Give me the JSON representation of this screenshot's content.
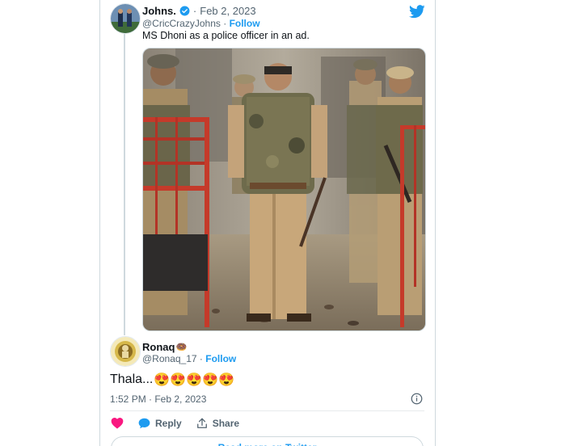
{
  "tweet": {
    "author_name": "Johns.",
    "date": "Feb 2, 2023",
    "handle": "@CricCrazyJohns",
    "follow_label": "Follow",
    "text": "MS Dhoni as a police officer in an ad.",
    "separator": "·"
  },
  "reply": {
    "author_name": "Ronaq",
    "name_emoji": "🍩",
    "handle": "@Ronaq_17",
    "follow_label": "Follow",
    "text": "Thala...",
    "emojis": "😍😍😍😍😍",
    "timestamp": "1:52 PM · Feb 2, 2023",
    "reply_label": "Reply",
    "share_label": "Share",
    "read_more_label": "Read more on Twitter"
  },
  "colors": {
    "accent": "#1d9bf0",
    "like": "#f91880",
    "muted": "#536471"
  },
  "icons": {
    "brand": "twitter-bird-icon",
    "verified": "verified-badge-icon",
    "info": "info-icon",
    "like": "heart-icon",
    "reply": "speech-bubble-icon",
    "share": "share-upload-icon"
  }
}
